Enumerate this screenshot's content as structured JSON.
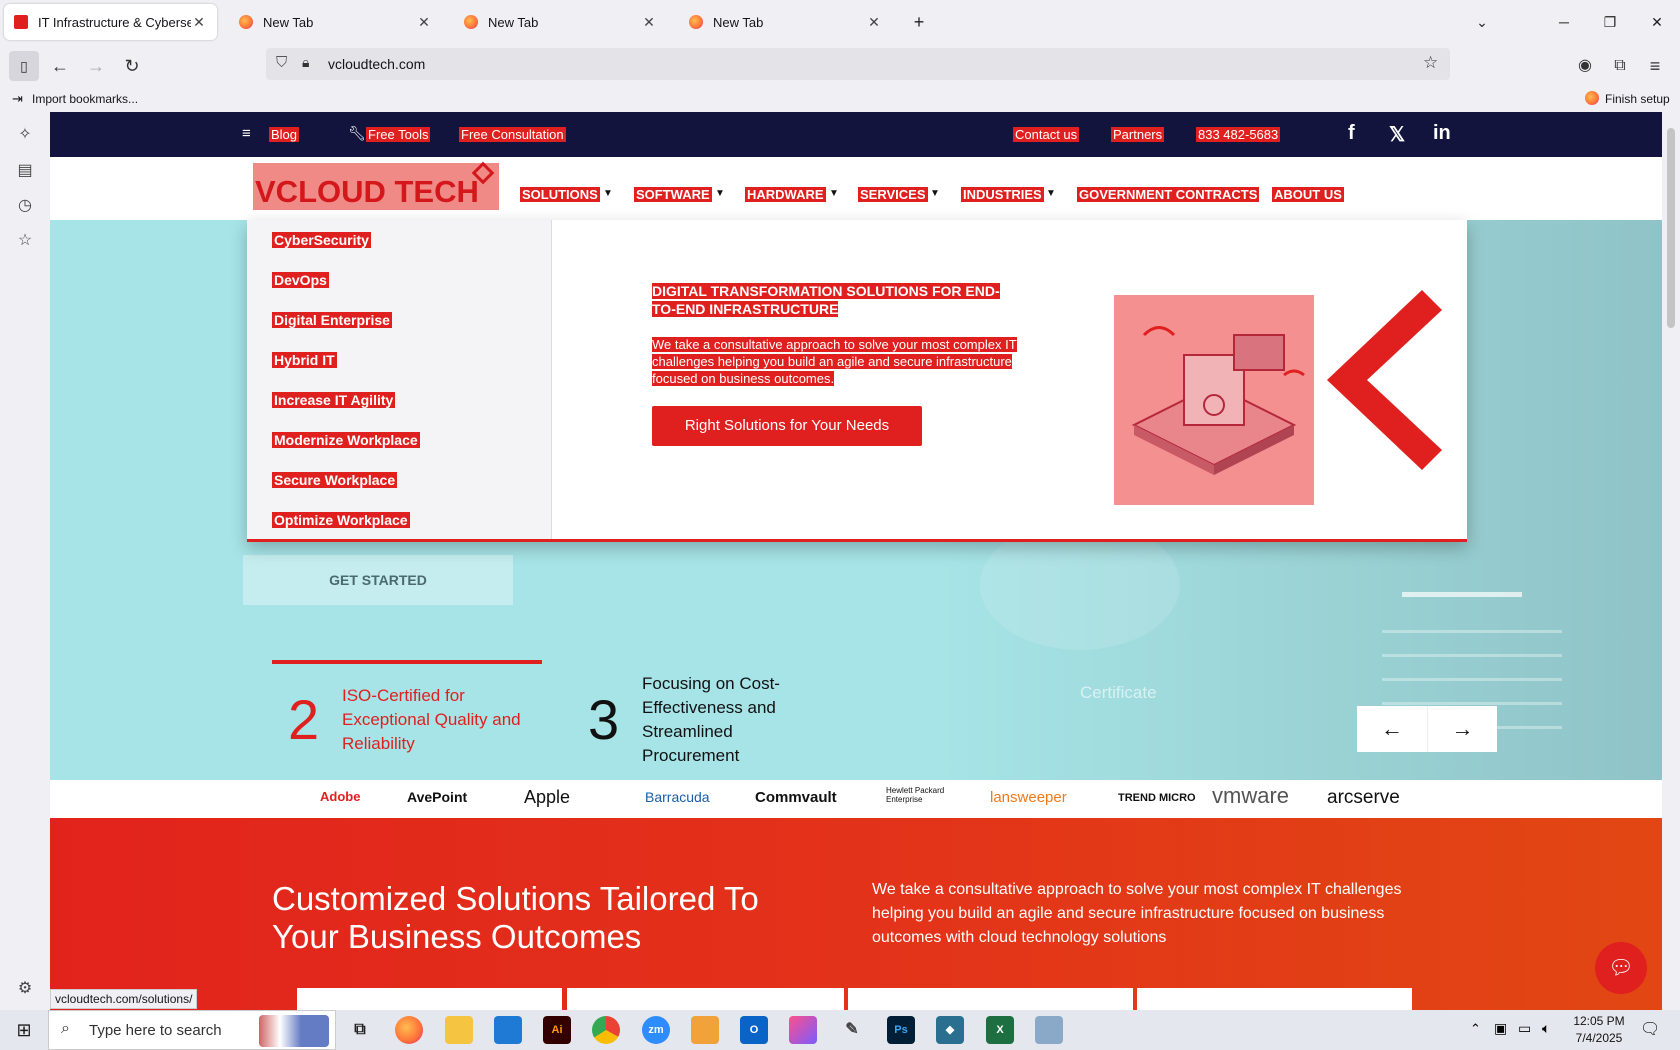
{
  "browser": {
    "tabs": [
      {
        "title": "IT Infrastructure & Cybersecurit",
        "active": true,
        "favicon_color": "#e0201f"
      },
      {
        "title": "New Tab",
        "active": false,
        "favicon_color": "#ff7139"
      },
      {
        "title": "New Tab",
        "active": false,
        "favicon_color": "#ff7139"
      },
      {
        "title": "New Tab",
        "active": false,
        "favicon_color": "#ff7139"
      }
    ],
    "new_tab_icon": "plus-icon",
    "url": "vcloudtech.com",
    "bookmarks_import": "Import bookmarks...",
    "finish_setup": "Finish setup",
    "status_url": "vcloudtech.com/solutions/"
  },
  "site": {
    "accent": "#e0201f",
    "navy": "#12143e",
    "top_links": {
      "blog": "Blog",
      "free_tools": "Free Tools",
      "free_consultation": "Free Consultation",
      "contact": "Contact us",
      "partners": "Partners",
      "phone": "833 482-5683"
    },
    "social": {
      "facebook": "f",
      "x": "𝕏",
      "linkedin": "in"
    },
    "logo": "VCLOUD TECH",
    "menu": {
      "solutions": "SOLUTIONS",
      "software": "SOFTWARE",
      "hardware": "HARDWARE",
      "services": "SERVICES",
      "industries": "INDUSTRIES",
      "government": "GOVERNMENT CONTRACTS",
      "about": "ABOUT US"
    },
    "mega": {
      "items": [
        "CyberSecurity",
        "DevOps",
        "Digital Enterprise",
        "Hybrid IT",
        "Increase IT Agility",
        "Modernize Workplace",
        "Secure Workplace",
        "Optimize Workplace"
      ],
      "heading": "DIGITAL TRANSFORMATION SOLUTIONS FOR END-TO-END INFRASTRUCTURE",
      "description": "We take a consultative approach to solve your most complex IT challenges helping you build an agile and secure infrastructure focused on business outcomes.",
      "button": "Right Solutions for Your Needs"
    },
    "hero": {
      "get_started": "GET STARTED",
      "certificate": "Certificate",
      "stats": [
        {
          "number": "2",
          "text": "ISO-Certified for Exceptional Quality and Reliability"
        },
        {
          "number": "3",
          "text": "Focusing on Cost-Effectiveness and Streamlined Procurement"
        }
      ],
      "prev": "←",
      "next": "→"
    },
    "brands": [
      "Adobe",
      "AvePoint",
      "Apple",
      "Barracuda",
      "Commvault",
      "Hewlett Packard Enterprise",
      "lansweeper",
      "TREND MICRO",
      "vmware",
      "arcserve"
    ],
    "section": {
      "title": "Customized Solutions Tailored To Your Business Outcomes",
      "description": "We take a consultative approach to solve your most complex IT challenges helping you build an agile and secure infrastructure focused on business outcomes with cloud technology solutions"
    }
  },
  "taskbar": {
    "search_placeholder": "Type here to search",
    "time": "12:05 PM",
    "date": "7/4/2025"
  }
}
